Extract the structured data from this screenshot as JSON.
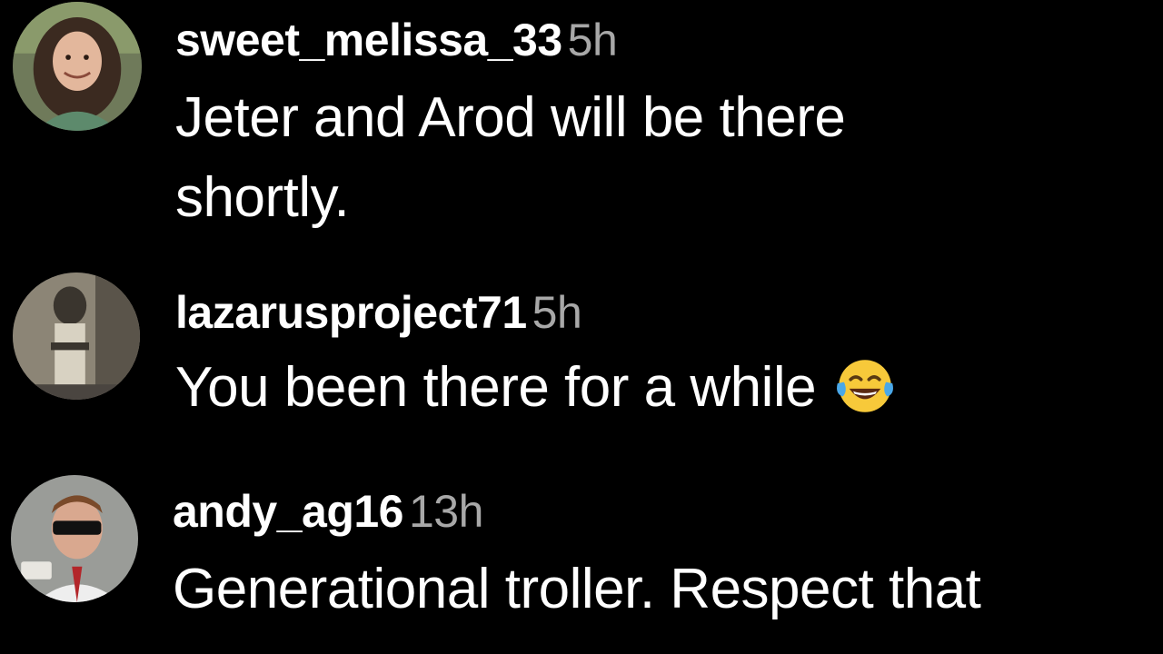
{
  "comments": [
    {
      "username": "sweet_melissa_33",
      "time": "5h",
      "line1": "Jeter and Arod will be there",
      "line2": "shortly.",
      "avatar": "user-photo-avatar"
    },
    {
      "username": "lazarusproject71",
      "time": "5h",
      "line1": "You been there for a while",
      "emoji": "tears-of-joy-emoji",
      "avatar": "user-photo-avatar"
    },
    {
      "username": "andy_ag16",
      "time": "13h",
      "line1": "Generational troller. Respect that",
      "avatar": "user-photo-avatar"
    }
  ],
  "colors": {
    "background": "#000000",
    "username": "#ffffff",
    "timestamp": "#a8a8a8",
    "text": "#ffffff"
  }
}
